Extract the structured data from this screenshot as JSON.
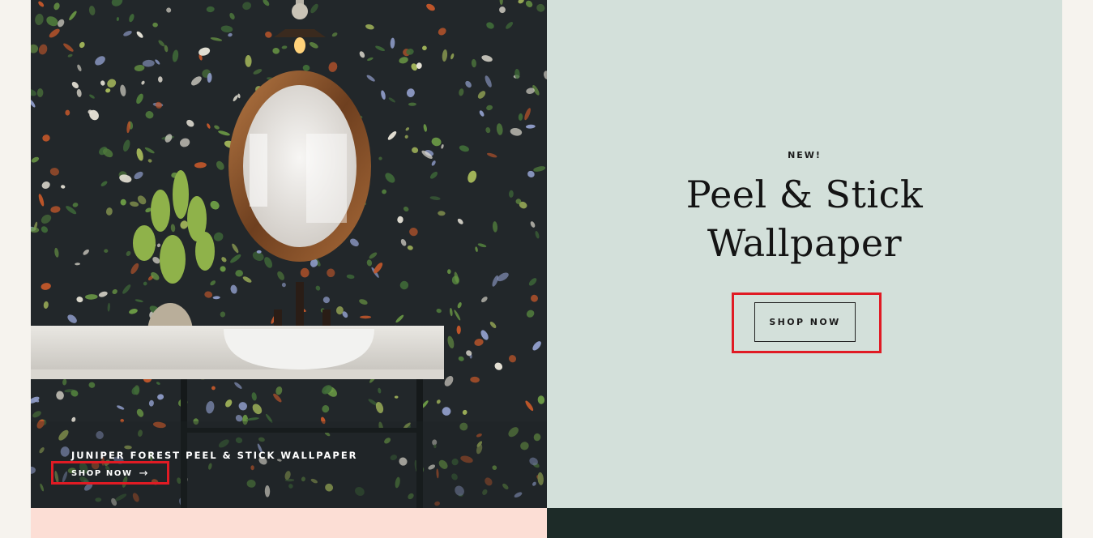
{
  "hero": {
    "image_alt": "Bathroom with dark floral Juniper Forest wallpaper, oval bronze mirror, vessel sink and plant",
    "caption_title": "JUNIPER FOREST PEEL & STICK WALLPAPER",
    "caption_link": "SHOP NOW",
    "arrow_icon": "arrow-right-icon",
    "arrow_glyph": "→"
  },
  "promo": {
    "eyebrow": "NEW!",
    "title_line1": "Peel & Stick",
    "title_line2": "Wallpaper",
    "button_label": "SHOP NOW",
    "background": "#d3e0da"
  },
  "colors": {
    "highlight": "#e01b24",
    "page_bg": "#f6f3ee",
    "pink_strip": "#fcded5",
    "dark_strip": "#1d2b28"
  }
}
